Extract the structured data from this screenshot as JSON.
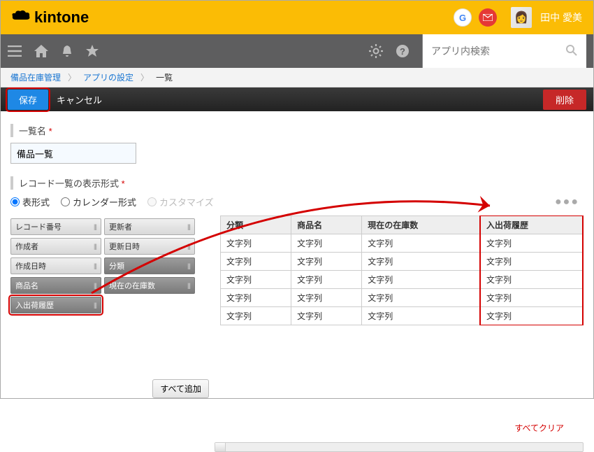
{
  "header": {
    "brand": "kintone",
    "g_label": "G",
    "username": "田中 愛美"
  },
  "search": {
    "placeholder": "アプリ内検索"
  },
  "breadcrumb": {
    "app": "備品在庫管理",
    "settings": "アプリの設定",
    "current": "一覧"
  },
  "actions": {
    "save": "保存",
    "cancel": "キャンセル",
    "delete": "削除"
  },
  "form": {
    "list_name_label": "一覧名",
    "list_name_value": "備品一覧",
    "display_label": "レコード一覧の表示形式",
    "opt_table": "表形式",
    "opt_calendar": "カレンダー形式",
    "opt_custom": "カスタマイズ"
  },
  "palette": [
    {
      "label": "レコード番号",
      "dark": false
    },
    {
      "label": "更新者",
      "dark": false
    },
    {
      "label": "作成者",
      "dark": false
    },
    {
      "label": "更新日時",
      "dark": false
    },
    {
      "label": "作成日時",
      "dark": false
    },
    {
      "label": "分類",
      "dark": true
    },
    {
      "label": "商品名",
      "dark": true
    },
    {
      "label": "現在の在庫数",
      "dark": true
    },
    {
      "label": "入出荷履歴",
      "dark": true,
      "highlight": true
    }
  ],
  "buttons": {
    "add_all": "すべて追加",
    "clear_all": "すべてクリア"
  },
  "preview": {
    "columns": [
      "分類",
      "商品名",
      "現在の在庫数",
      "入出荷履歴"
    ],
    "cell": "文字列",
    "rows": 5
  }
}
